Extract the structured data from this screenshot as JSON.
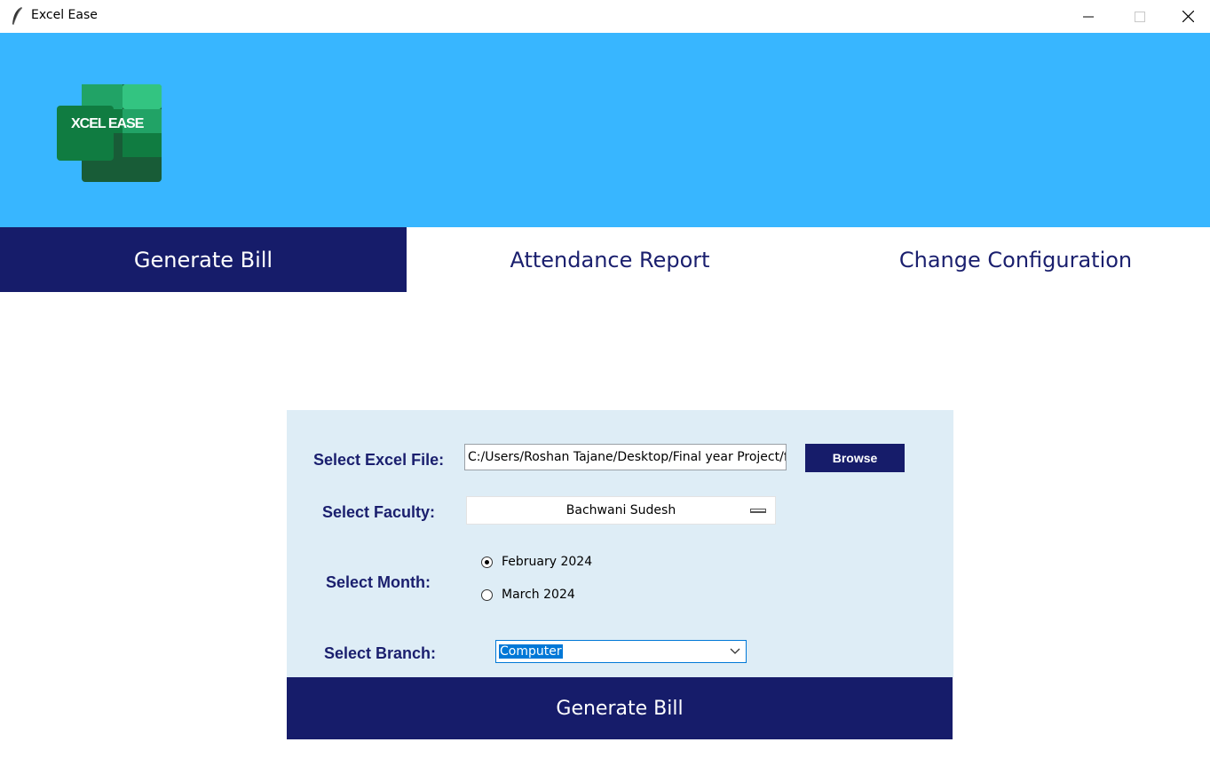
{
  "window": {
    "title": "Excel Ease",
    "icon": "feather-icon",
    "controls": [
      "minimize-icon",
      "maximize-icon",
      "close-icon"
    ]
  },
  "header": {
    "logo_text_main": "XCEL EASE",
    "bg_color": "#38b6ff"
  },
  "tabs": [
    {
      "label": "Generate Bill",
      "active": true
    },
    {
      "label": "Attendance Report",
      "active": false
    },
    {
      "label": "Change Configuration",
      "active": false
    }
  ],
  "form": {
    "file_label": "Select Excel File:",
    "file_value": "C:/Users/Roshan Tajane/Desktop/Final year Project/file",
    "browse_label": "Browse",
    "faculty_label": "Select Faculty:",
    "faculty_value": "Bachwani Sudesh",
    "month_label": "Select Month:",
    "month_options": [
      {
        "label": "February 2024",
        "checked": true
      },
      {
        "label": "March 2024",
        "checked": false
      }
    ],
    "branch_label": "Select Branch:",
    "branch_value": "Computer"
  },
  "actions": {
    "generate_label": "Generate Bill"
  },
  "colors": {
    "primary_navy": "#161c6a",
    "panel_bg": "#deedf6",
    "header_blue": "#38b6ff"
  }
}
